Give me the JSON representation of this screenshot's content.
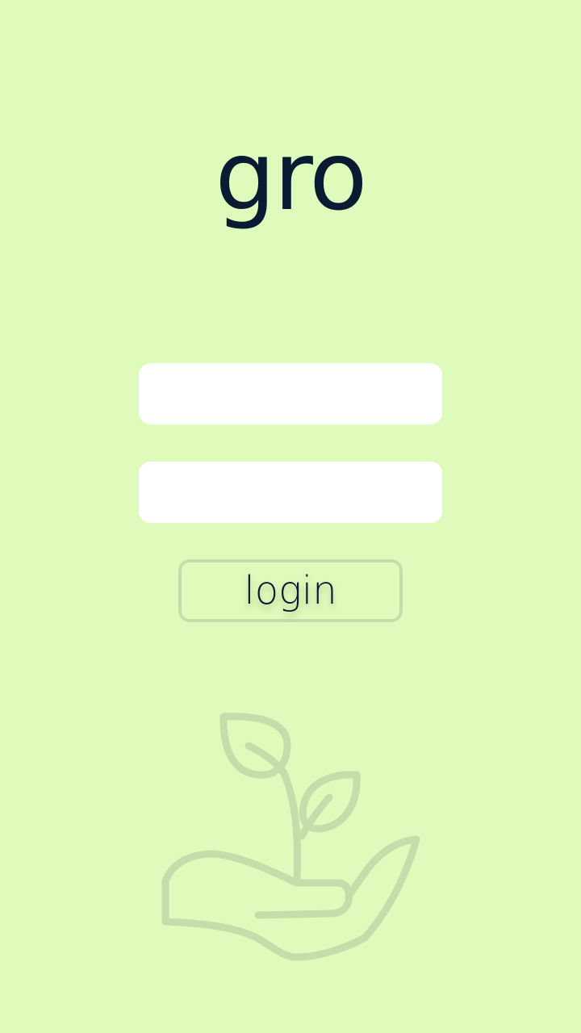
{
  "app": {
    "title": "gro"
  },
  "form": {
    "username": {
      "value": "",
      "placeholder": ""
    },
    "password": {
      "value": "",
      "placeholder": ""
    },
    "login_label": "login"
  },
  "illustration": {
    "icon": "hand-holding-plant-icon",
    "color": "#c4ddaa"
  },
  "colors": {
    "background": "#dffbbb",
    "text": "#0b1a33",
    "field": "#ffffff",
    "accent": "#c4ddaa"
  }
}
